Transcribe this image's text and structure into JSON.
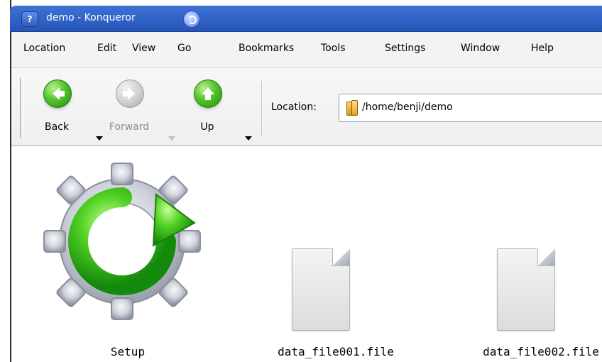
{
  "window": {
    "title": "demo - Konqueror",
    "title_button": "?"
  },
  "menubar": {
    "items": [
      "Location",
      "Edit",
      "View",
      "Go",
      "Bookmarks",
      "Tools",
      "Settings",
      "Window",
      "Help"
    ]
  },
  "toolbar": {
    "back_label": "Back",
    "forward_label": "Forward",
    "up_label": "Up",
    "location_label": "Location:",
    "location_value": "/home/benji/demo"
  },
  "files": [
    {
      "name": "Setup",
      "icon": "setup-gear-icon"
    },
    {
      "name": "data_file001.file",
      "icon": "document-icon"
    },
    {
      "name": "data_file002.file",
      "icon": "document-icon"
    }
  ],
  "colors": {
    "titlebar": "#3365c9",
    "green": "#55c42a",
    "background": "#ffffff"
  }
}
